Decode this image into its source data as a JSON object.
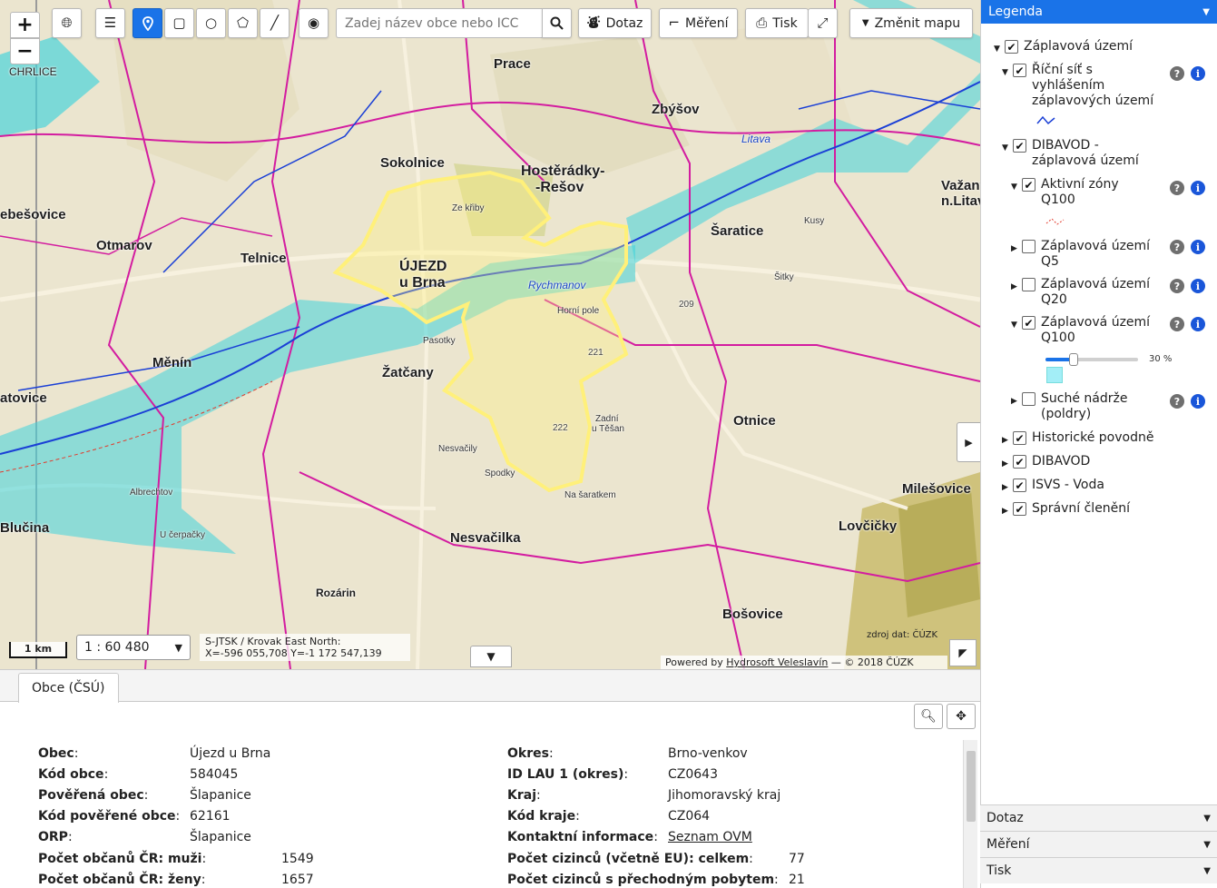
{
  "toolbar": {
    "zoom_in": "+",
    "zoom_out": "−",
    "search_placeholder": "Zadej název obce nebo ICC",
    "dotaz_label": "Dotaz",
    "mereni_label": "Měření",
    "tisk_label": "Tisk",
    "zmenit_mapu_label": "Změnit mapu"
  },
  "map": {
    "scale_bar": "1 km",
    "scale_value": "1 : 60 480",
    "coords_line1": "S-JTSK / Krovak East North:",
    "coords_line2": "X=-596 055,708 Y=-1 172 547,139",
    "credits_prefix": "Powered by ",
    "credits_link": "Hydrosoft Veleslavín",
    "credits_suffix": " — © 2018 ČÚZK",
    "source": "zdroj dat: ČÚZK",
    "places": {
      "prace": "Prace",
      "sokolnice": "Sokolnice",
      "hosteradky1": "Hostěrádky-",
      "hosteradky2": "-Rešov",
      "zbysov": "Zbýšov",
      "ujezd1": "ÚJEZD",
      "ujezd2": "u Brna",
      "telnice": "Telnice",
      "otmarov": "Otmarov",
      "menin": "Měnín",
      "zatcany": "Žatčany",
      "saratice": "Šaratice",
      "otnice": "Otnice",
      "nesvacilka": "Nesvačilka",
      "blucina": "Blučina",
      "milesovice": "Milešovice",
      "lovcicky": "Lovčičky",
      "bosovice": "Bošovice",
      "rozarin": "Rozárin",
      "vazany1": "Važany",
      "vazany2": "n.Litav",
      "atovice": "atovice",
      "ebesovice": "ebešovice",
      "chrlice": "CHRLICE",
      "krizy": "Ze křiby",
      "homi_pole": "Horní pole",
      "rychmanov": "Rychmanov",
      "litava": "Litava",
      "zadni": "Zadní",
      "u_tesan": "u Těšan",
      "nasaratkem": "Na šaratkem",
      "spodky": "Spodky",
      "nesvacily": "Nesvačily",
      "pasotky": "Pasotky",
      "sitky": "Šitky",
      "ucerpacky": "U čerpačky",
      "albrechtov": "Albrechtov",
      "kusy": "Kusy",
      "q221": "221",
      "q222": "222",
      "q209": "209"
    }
  },
  "legend": {
    "title": "Legenda",
    "items": [
      {
        "label": "Záplavová území",
        "checked": true
      },
      {
        "label": "Říční síť s vyhlášením záplavových území",
        "checked": true
      },
      {
        "label": "DIBAVOD - záplavová území",
        "checked": true
      },
      {
        "label": "Aktivní zóny Q100",
        "checked": true
      },
      {
        "label": "Záplavová území Q5",
        "checked": false
      },
      {
        "label": "Záplavová území Q20",
        "checked": false
      },
      {
        "label": "Záplavová území Q100",
        "checked": true
      },
      {
        "label": "Suché nádrže (poldry)",
        "checked": false
      },
      {
        "label": "Historické povodně",
        "checked": true
      },
      {
        "label": "DIBAVOD",
        "checked": true
      },
      {
        "label": "ISVS - Voda",
        "checked": true
      },
      {
        "label": "Správní členění",
        "checked": true
      }
    ],
    "opacity": "30 %",
    "opacity_value": 0.3,
    "accordions": [
      "Dotaz",
      "Měření",
      "Tisk"
    ]
  },
  "panel": {
    "tab": "Obce (ČSÚ)",
    "left": [
      {
        "label": "Obec",
        "value": "Újezd u Brna"
      },
      {
        "label": "Kód obce",
        "value": "584045"
      },
      {
        "label": "Pověřená obec",
        "value": "Šlapanice"
      },
      {
        "label": "Kód pověřené obce",
        "value": "62161"
      },
      {
        "label": "ORP",
        "value": "Šlapanice"
      },
      {
        "label": "Počet občanů ČR: muži",
        "value": "1549"
      },
      {
        "label": "Počet občanů ČR: ženy",
        "value": "1657"
      }
    ],
    "right": [
      {
        "label": "Okres",
        "value": "Brno-venkov"
      },
      {
        "label": "ID LAU 1 (okres)",
        "value": "CZ0643"
      },
      {
        "label": "Kraj",
        "value": "Jihomoravský kraj"
      },
      {
        "label": "Kód kraje",
        "value": "CZ064"
      },
      {
        "label": "Kontaktní informace",
        "value": "Seznam OVM"
      },
      {
        "label": "Počet cizinců (včetně EU): celkem",
        "value": "77"
      },
      {
        "label": "Počet cizinců s přechodným pobytem",
        "value": "21"
      }
    ]
  },
  "colors": {
    "accent": "#1a73e8",
    "flood_zone": "#3fd3dc",
    "boundary": "#d31ca0",
    "river": "#1a3fd6",
    "selection": "#fff07a"
  }
}
